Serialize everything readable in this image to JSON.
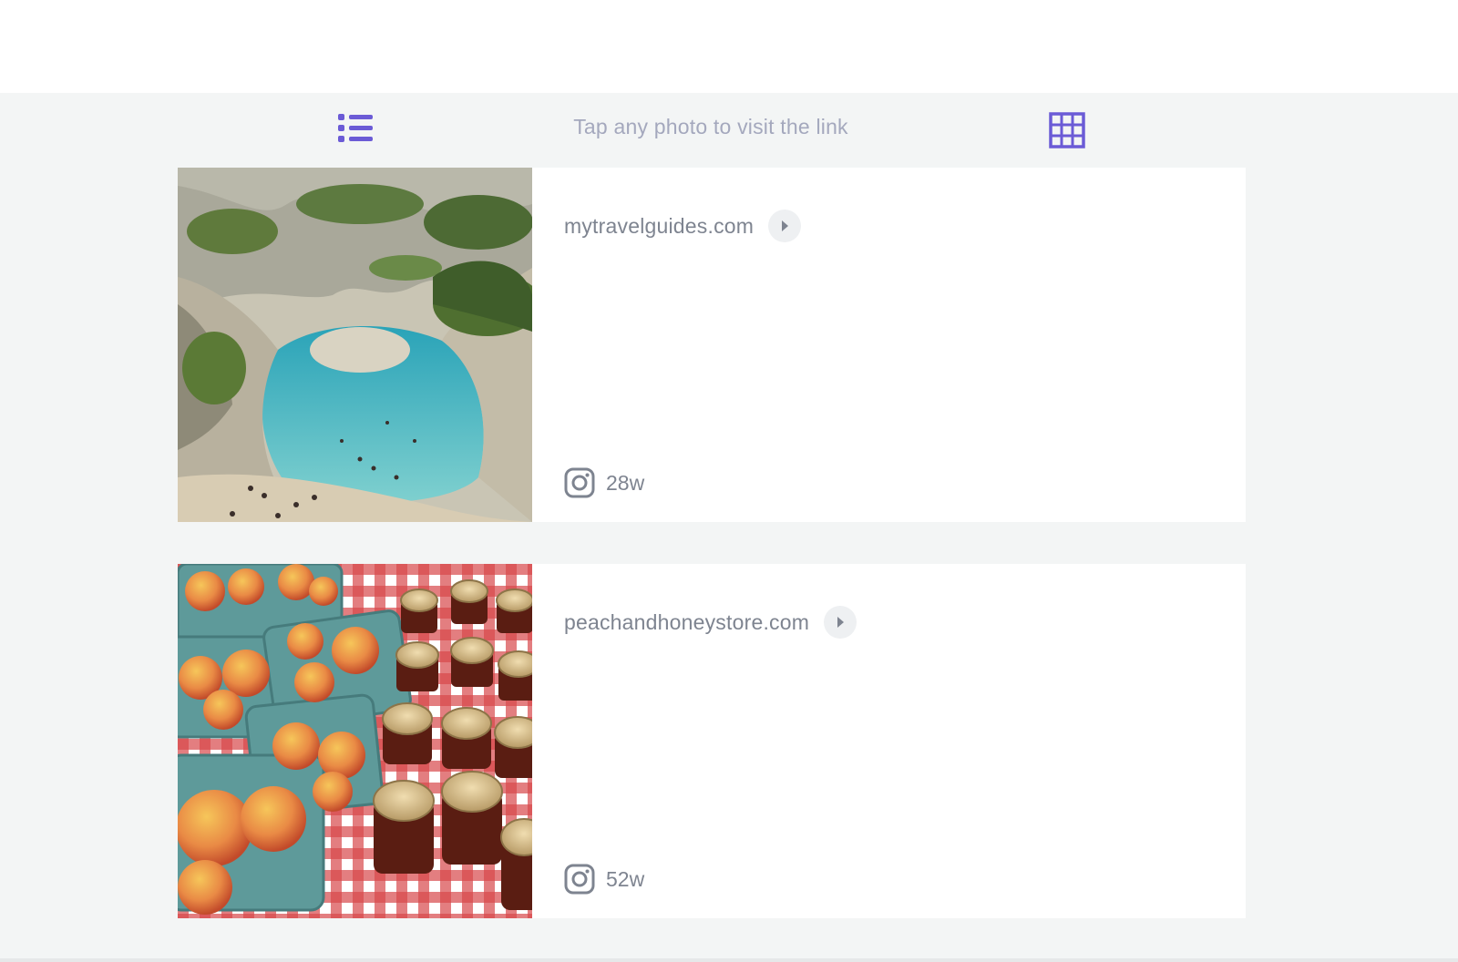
{
  "toolbar": {
    "hint": "Tap any photo to visit the link",
    "list_icon": "list-icon",
    "grid_icon": "grid-icon",
    "accent_color": "#6b5bd6"
  },
  "posts": [
    {
      "link": "mytravelguides.com",
      "age": "28w",
      "source_icon": "instagram-icon",
      "photo": "coastal-cove-beach-photo"
    },
    {
      "link": "peachandhoneystore.com",
      "age": "52w",
      "source_icon": "instagram-icon",
      "photo": "peaches-and-honey-jars-photo"
    }
  ]
}
